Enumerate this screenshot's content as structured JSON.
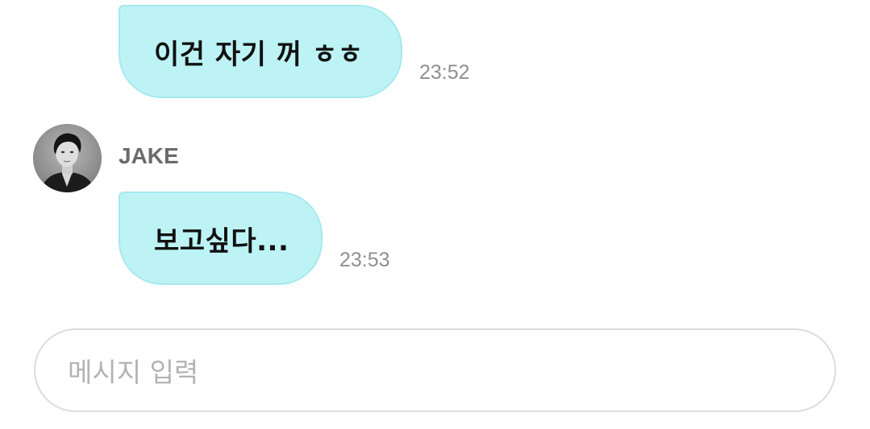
{
  "chat": {
    "messages": [
      {
        "text": "이건 자기 꺼 ㅎㅎ",
        "time": "23:52"
      },
      {
        "text": "보고싶다...",
        "time": "23:53"
      }
    ],
    "sender": {
      "name": "JAKE"
    }
  },
  "composer": {
    "placeholder": "메시지 입력"
  },
  "colors": {
    "bubble": "#bdf3f5",
    "bubble_border": "#a8e8ee",
    "time": "#8f8f8f",
    "sender_name": "#6a6a6a",
    "placeholder": "#b3b3b3"
  }
}
